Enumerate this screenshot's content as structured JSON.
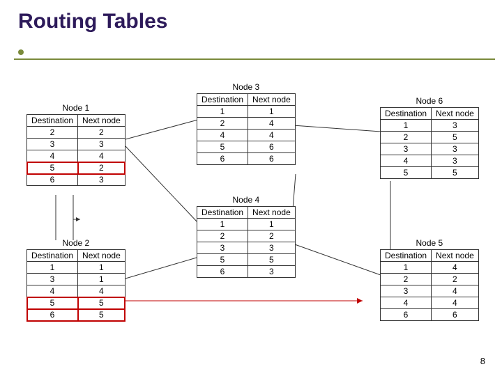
{
  "title": "Routing Tables",
  "page_number": "8",
  "col_dest": "Destination",
  "col_next": "Next node",
  "tables": {
    "n1": {
      "title": "Node 1",
      "rows": [
        [
          "2",
          "2"
        ],
        [
          "3",
          "3"
        ],
        [
          "4",
          "4"
        ],
        [
          "5",
          "2"
        ],
        [
          "6",
          "3"
        ]
      ],
      "hl": [
        3
      ]
    },
    "n2": {
      "title": "Node 2",
      "rows": [
        [
          "1",
          "1"
        ],
        [
          "3",
          "1"
        ],
        [
          "4",
          "4"
        ],
        [
          "5",
          "5"
        ],
        [
          "6",
          "5"
        ]
      ],
      "hl": [
        3,
        4
      ]
    },
    "n3": {
      "title": "Node 3",
      "rows": [
        [
          "1",
          "1"
        ],
        [
          "2",
          "4"
        ],
        [
          "4",
          "4"
        ],
        [
          "5",
          "6"
        ],
        [
          "6",
          "6"
        ]
      ],
      "hl": []
    },
    "n4": {
      "title": "Node 4",
      "rows": [
        [
          "1",
          "1"
        ],
        [
          "2",
          "2"
        ],
        [
          "3",
          "3"
        ],
        [
          "5",
          "5"
        ],
        [
          "6",
          "3"
        ]
      ],
      "hl": []
    },
    "n5": {
      "title": "Node 5",
      "rows": [
        [
          "1",
          "4"
        ],
        [
          "2",
          "2"
        ],
        [
          "3",
          "4"
        ],
        [
          "4",
          "4"
        ],
        [
          "6",
          "6"
        ]
      ],
      "hl": []
    },
    "n6": {
      "title": "Node 6",
      "rows": [
        [
          "1",
          "3"
        ],
        [
          "2",
          "5"
        ],
        [
          "3",
          "3"
        ],
        [
          "4",
          "3"
        ],
        [
          "5",
          "5"
        ]
      ],
      "hl": []
    }
  }
}
